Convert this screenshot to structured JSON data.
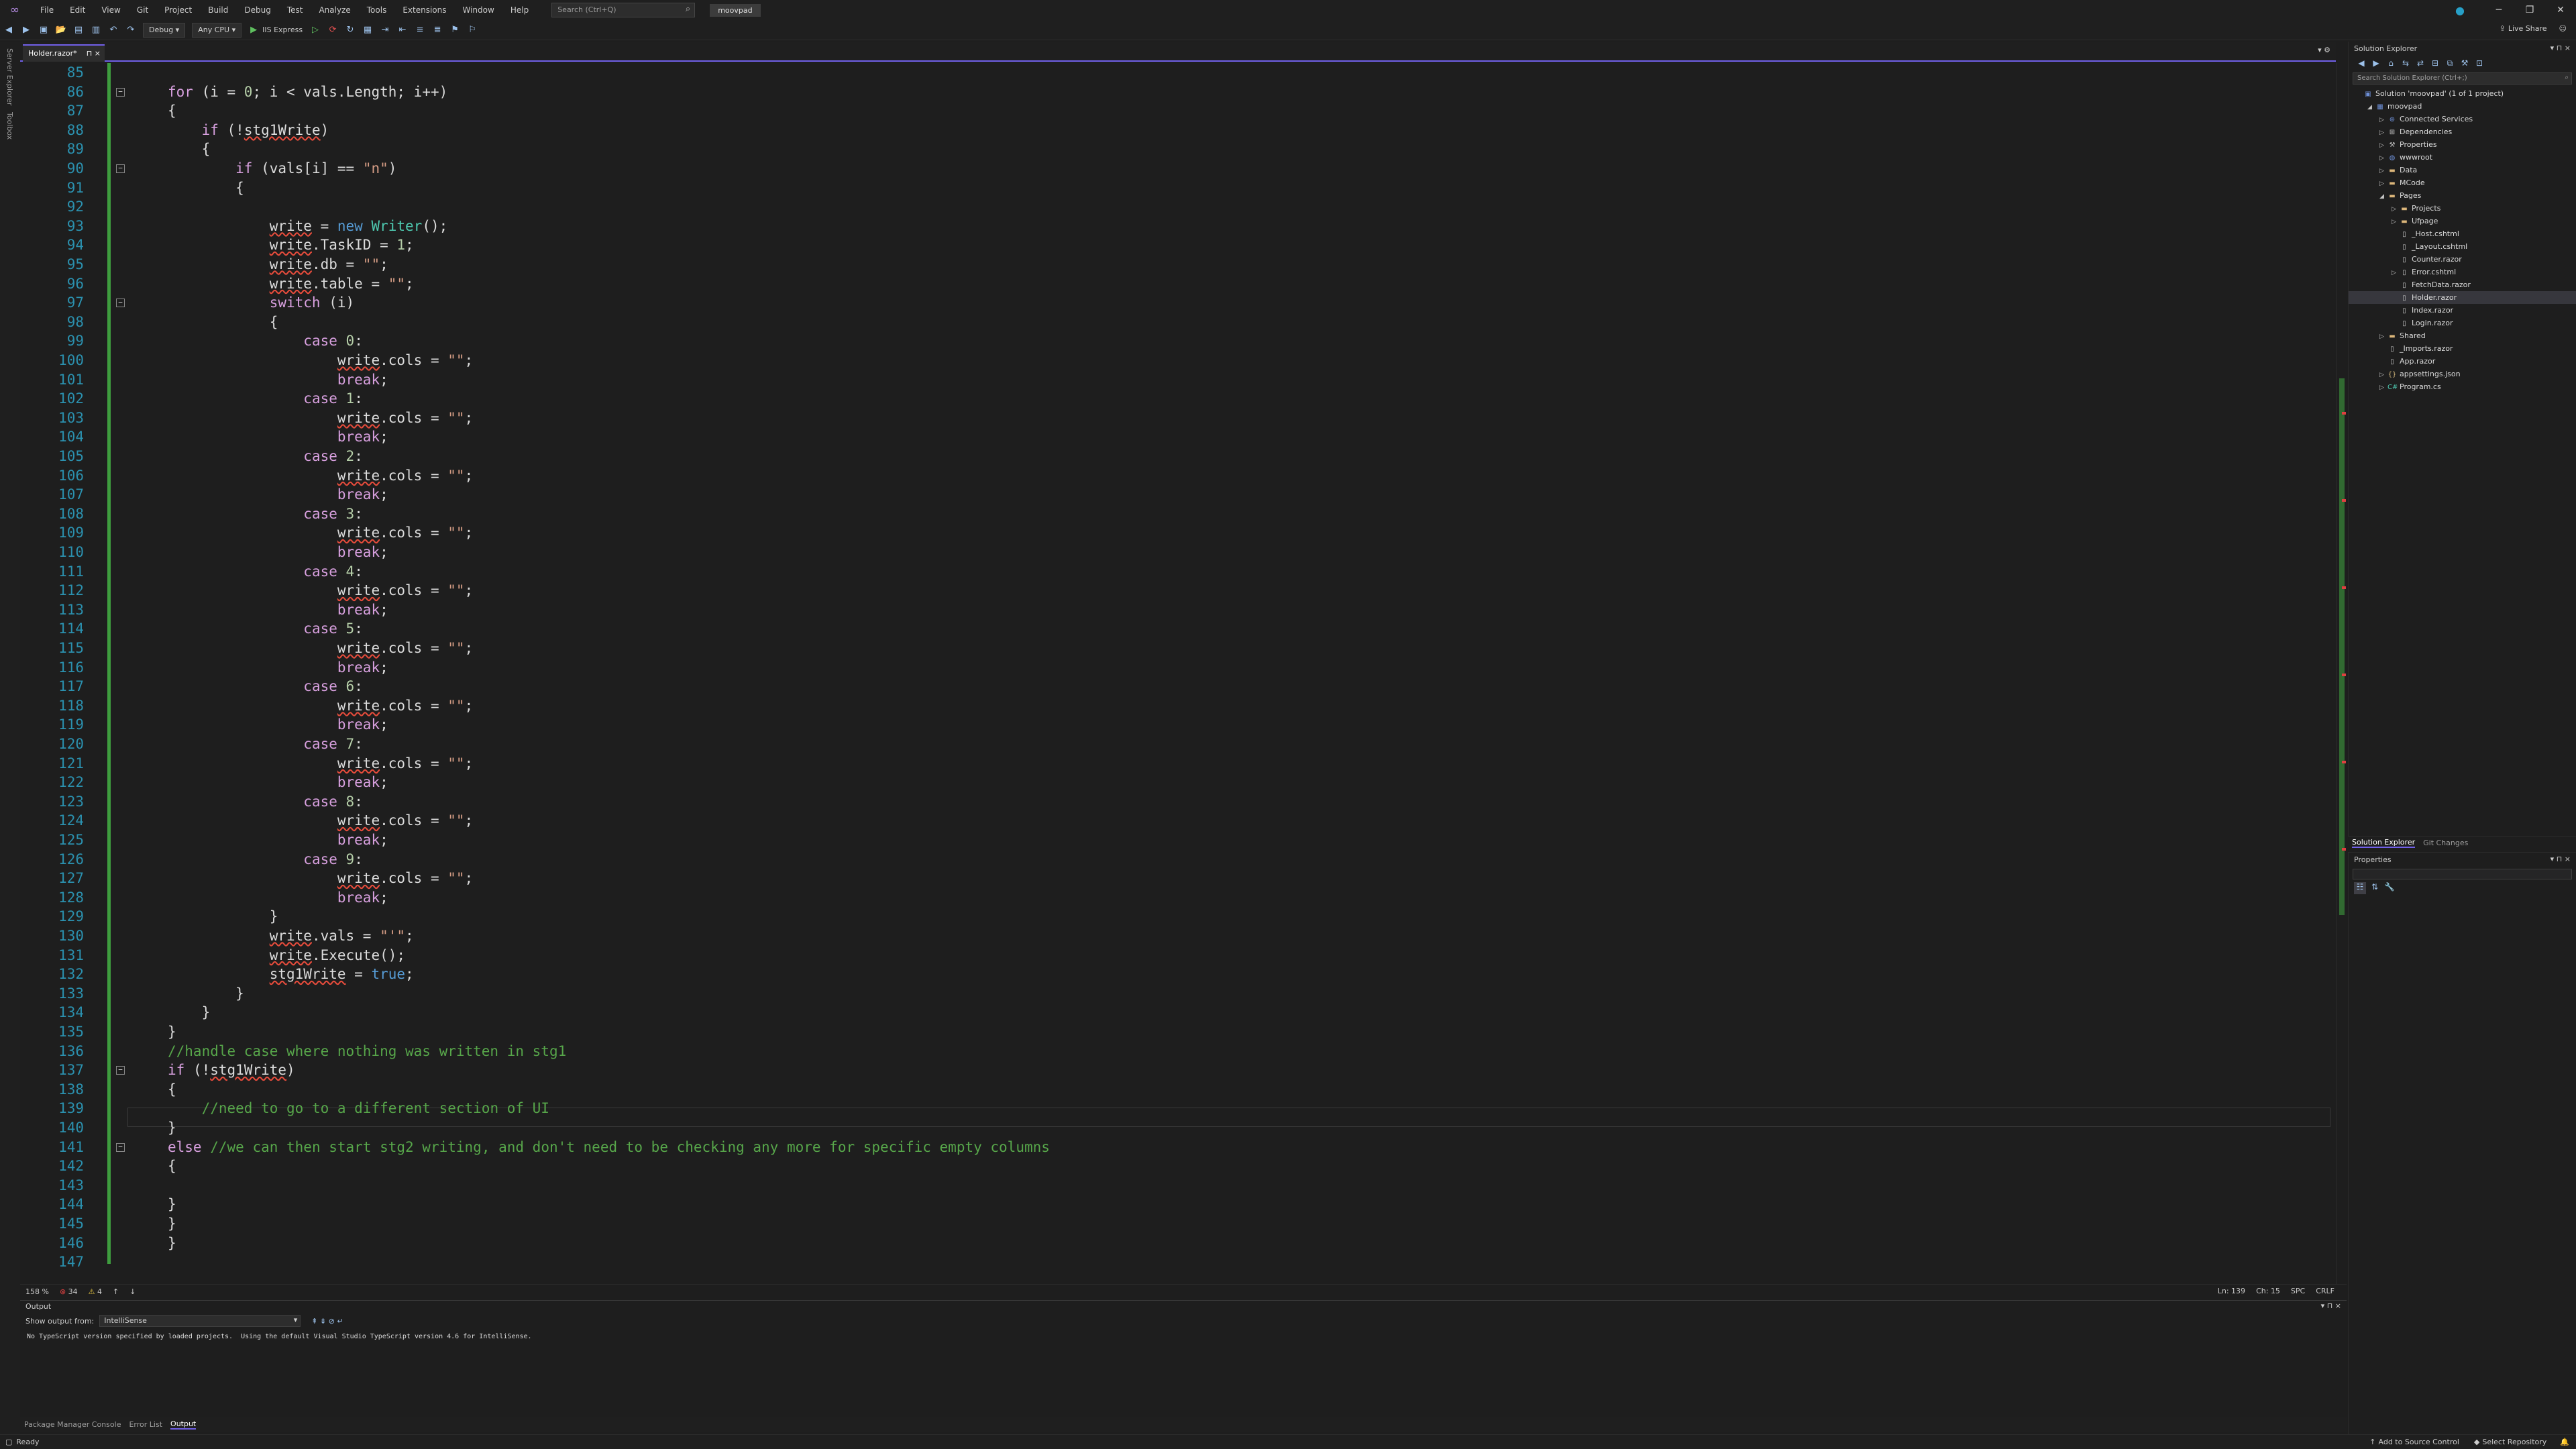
{
  "menu": {
    "items": [
      "File",
      "Edit",
      "View",
      "Git",
      "Project",
      "Build",
      "Debug",
      "Test",
      "Analyze",
      "Tools",
      "Extensions",
      "Window",
      "Help"
    ],
    "search_placeholder": "Search (Ctrl+Q)",
    "project_name": "moovpad"
  },
  "toolbar": {
    "configuration": "Debug",
    "platform": "Any CPU",
    "run_target": "IIS Express"
  },
  "live_share": "Live Share",
  "side_strip": [
    "Server Explorer",
    "Toolbox"
  ],
  "tab": {
    "label": "Holder.razor*",
    "pin": "⊓",
    "close": "×"
  },
  "code_lines": [
    {
      "n": "85",
      "t": ""
    },
    {
      "n": "86",
      "t": "for (i = 0; i < vals.Length; i++)"
    },
    {
      "n": "87",
      "t": "{"
    },
    {
      "n": "88",
      "t": "    if (!stg1Write)"
    },
    {
      "n": "89",
      "t": "    {"
    },
    {
      "n": "90",
      "t": "        if (vals[i] == \"n\")"
    },
    {
      "n": "91",
      "t": "        {"
    },
    {
      "n": "92",
      "t": ""
    },
    {
      "n": "93",
      "t": "            write = new Writer();"
    },
    {
      "n": "94",
      "t": "            write.TaskID = 1;"
    },
    {
      "n": "95",
      "t": "            write.db = \"\";"
    },
    {
      "n": "96",
      "t": "            write.table = \"\";"
    },
    {
      "n": "97",
      "t": "            switch (i)"
    },
    {
      "n": "98",
      "t": "            {"
    },
    {
      "n": "99",
      "t": "                case 0:"
    },
    {
      "n": "100",
      "t": "                    write.cols = \"\";"
    },
    {
      "n": "101",
      "t": "                    break;"
    },
    {
      "n": "102",
      "t": "                case 1:"
    },
    {
      "n": "103",
      "t": "                    write.cols = \"\";"
    },
    {
      "n": "104",
      "t": "                    break;"
    },
    {
      "n": "105",
      "t": "                case 2:"
    },
    {
      "n": "106",
      "t": "                    write.cols = \"\";"
    },
    {
      "n": "107",
      "t": "                    break;"
    },
    {
      "n": "108",
      "t": "                case 3:"
    },
    {
      "n": "109",
      "t": "                    write.cols = \"\";"
    },
    {
      "n": "110",
      "t": "                    break;"
    },
    {
      "n": "111",
      "t": "                case 4:"
    },
    {
      "n": "112",
      "t": "                    write.cols = \"\";"
    },
    {
      "n": "113",
      "t": "                    break;"
    },
    {
      "n": "114",
      "t": "                case 5:"
    },
    {
      "n": "115",
      "t": "                    write.cols = \"\";"
    },
    {
      "n": "116",
      "t": "                    break;"
    },
    {
      "n": "117",
      "t": "                case 6:"
    },
    {
      "n": "118",
      "t": "                    write.cols = \"\";"
    },
    {
      "n": "119",
      "t": "                    break;"
    },
    {
      "n": "120",
      "t": "                case 7:"
    },
    {
      "n": "121",
      "t": "                    write.cols = \"\";"
    },
    {
      "n": "122",
      "t": "                    break;"
    },
    {
      "n": "123",
      "t": "                case 8:"
    },
    {
      "n": "124",
      "t": "                    write.cols = \"\";"
    },
    {
      "n": "125",
      "t": "                    break;"
    },
    {
      "n": "126",
      "t": "                case 9:"
    },
    {
      "n": "127",
      "t": "                    write.cols = \"\";"
    },
    {
      "n": "128",
      "t": "                    break;"
    },
    {
      "n": "129",
      "t": "            }"
    },
    {
      "n": "130",
      "t": "            write.vals = \"'\";"
    },
    {
      "n": "131",
      "t": "            write.Execute();"
    },
    {
      "n": "132",
      "t": "            stg1Write = true;"
    },
    {
      "n": "133",
      "t": "        }"
    },
    {
      "n": "134",
      "t": "    }"
    },
    {
      "n": "135",
      "t": "}"
    },
    {
      "n": "136",
      "t": "//handle case where nothing was written in stg1"
    },
    {
      "n": "137",
      "t": "if (!stg1Write)"
    },
    {
      "n": "138",
      "t": "{"
    },
    {
      "n": "139",
      "t": "    //need to go to a different section of UI"
    },
    {
      "n": "140",
      "t": "}"
    },
    {
      "n": "141",
      "t": "else //we can then start stg2 writing, and don't need to be checking any more for specific empty columns"
    },
    {
      "n": "142",
      "t": "{"
    },
    {
      "n": "143",
      "t": ""
    },
    {
      "n": "144",
      "t": "}"
    },
    {
      "n": "145",
      "t": "}"
    },
    {
      "n": "146",
      "t": "}"
    },
    {
      "n": "147",
      "t": ""
    }
  ],
  "editor_status": {
    "zoom": "158 %",
    "errors": "34",
    "warnings": "4",
    "line": "Ln: 139",
    "col": "Ch: 15",
    "spc": "SPC",
    "eol": "CRLF"
  },
  "output": {
    "title": "Output",
    "show_from_label": "Show output from:",
    "source": "IntelliSense",
    "text": "No TypeScript version specified by loaded projects.  Using the default Visual Studio TypeScript version 4.6 for IntelliSense."
  },
  "bottom_tabs": [
    "Package Manager Console",
    "Error List",
    "Output"
  ],
  "status": {
    "ready": "Ready",
    "source_control": "Add to Source Control",
    "repository": "Select Repository"
  },
  "solution_explorer": {
    "title": "Solution Explorer",
    "search_placeholder": "Search Solution Explorer (Ctrl+;)",
    "items": [
      {
        "label": "Solution 'moovpad' (1 of 1 project)",
        "indent": 0,
        "icon": "solution-icon",
        "arrow": ""
      },
      {
        "label": "moovpad",
        "indent": 1,
        "icon": "project-icon",
        "arrow": "◢"
      },
      {
        "label": "Connected Services",
        "indent": 2,
        "icon": "connected-services-icon",
        "arrow": "▷"
      },
      {
        "label": "Dependencies",
        "indent": 2,
        "icon": "dependencies-icon",
        "arrow": "▷"
      },
      {
        "label": "Properties",
        "indent": 2,
        "icon": "properties-icon",
        "arrow": "▷"
      },
      {
        "label": "wwwroot",
        "indent": 2,
        "icon": "globe-icon",
        "arrow": "▷"
      },
      {
        "label": "Data",
        "indent": 2,
        "icon": "folder-icon",
        "arrow": "▷"
      },
      {
        "label": "MCode",
        "indent": 2,
        "icon": "folder-icon",
        "arrow": "▷"
      },
      {
        "label": "Pages",
        "indent": 2,
        "icon": "folder-icon",
        "arrow": "◢"
      },
      {
        "label": "Projects",
        "indent": 3,
        "icon": "folder-icon",
        "arrow": "▷"
      },
      {
        "label": "Ufpage",
        "indent": 3,
        "icon": "folder-icon",
        "arrow": "▷"
      },
      {
        "label": "_Host.cshtml",
        "indent": 3,
        "icon": "file-icon",
        "arrow": ""
      },
      {
        "label": "_Layout.cshtml",
        "indent": 3,
        "icon": "file-icon",
        "arrow": ""
      },
      {
        "label": "Counter.razor",
        "indent": 3,
        "icon": "file-icon",
        "arrow": ""
      },
      {
        "label": "Error.cshtml",
        "indent": 3,
        "icon": "file-icon",
        "arrow": "▷"
      },
      {
        "label": "FetchData.razor",
        "indent": 3,
        "icon": "file-icon",
        "arrow": ""
      },
      {
        "label": "Holder.razor",
        "indent": 3,
        "icon": "file-icon",
        "arrow": "",
        "selected": true
      },
      {
        "label": "Index.razor",
        "indent": 3,
        "icon": "file-icon",
        "arrow": ""
      },
      {
        "label": "Login.razor",
        "indent": 3,
        "icon": "file-icon",
        "arrow": ""
      },
      {
        "label": "Shared",
        "indent": 2,
        "icon": "folder-icon",
        "arrow": "▷"
      },
      {
        "label": "_Imports.razor",
        "indent": 2,
        "icon": "file-icon",
        "arrow": ""
      },
      {
        "label": "App.razor",
        "indent": 2,
        "icon": "file-icon",
        "arrow": ""
      },
      {
        "label": "appsettings.json",
        "indent": 2,
        "icon": "json-icon",
        "arrow": "▷"
      },
      {
        "label": "Program.cs",
        "indent": 2,
        "icon": "csharp-icon",
        "arrow": "▷"
      }
    ],
    "tabs": [
      "Solution Explorer",
      "Git Changes"
    ]
  },
  "properties": {
    "title": "Properties"
  },
  "colors": {
    "accent": "#7160e8",
    "keyword": "#569cd6",
    "control": "#d8a0df",
    "string": "#d69d85",
    "comment": "#57a64a",
    "linenum": "#2b91af"
  }
}
